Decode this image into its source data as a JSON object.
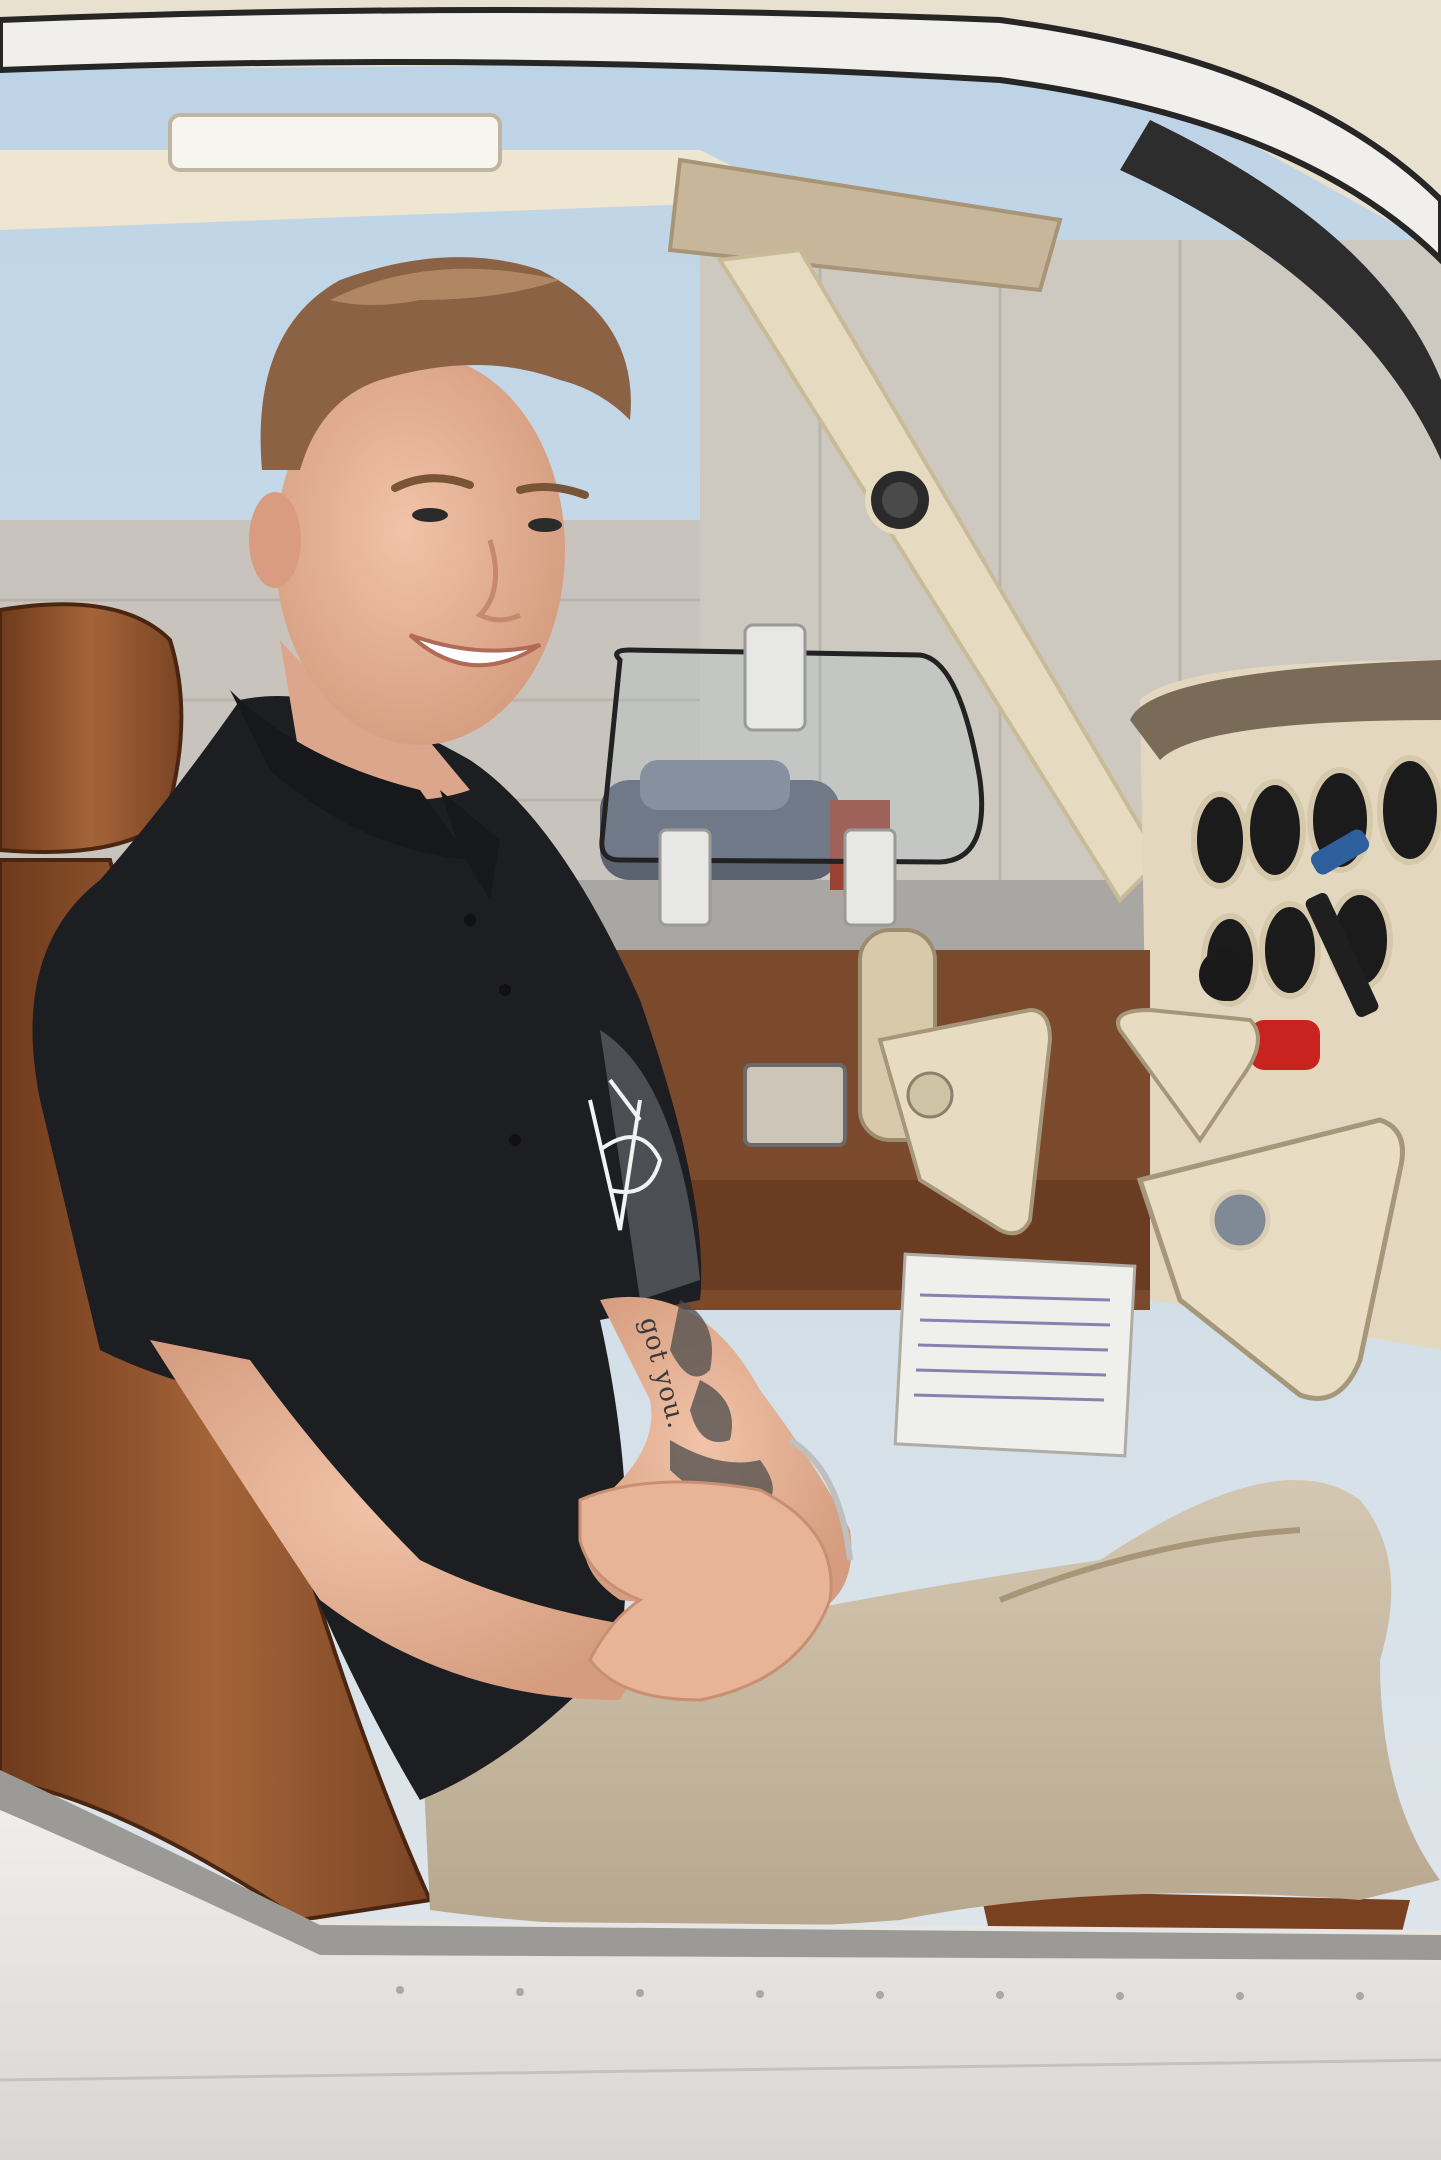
{
  "scene": {
    "subject": "photo",
    "tattoo_text": "got you."
  },
  "colors": {
    "sky": "#cfe0ec",
    "hangar": "#c9c4bb",
    "cabin_frame": "#e8dcc2",
    "fuselage": "#e4e3e1",
    "seat_leather": "#8a4f2b",
    "shirt": "#1c1e22",
    "pants": "#c9bba4",
    "skin": "#e7b49a",
    "hair": "#8b6344",
    "panel": "#e3d8bf",
    "knob_red": "#c8231f",
    "yoke_blue": "#2c5f9c"
  }
}
